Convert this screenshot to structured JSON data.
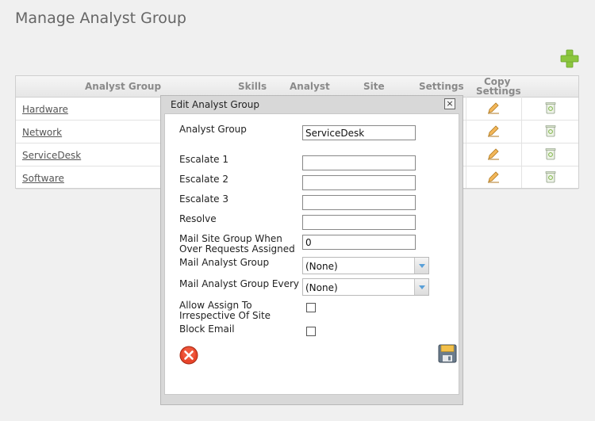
{
  "page": {
    "title": "Manage Analyst Group"
  },
  "toolbar": {
    "add_icon": "plus-icon",
    "add_color": "#8cc63f"
  },
  "grid": {
    "columns": {
      "group": "Analyst Group",
      "skills": "Skills",
      "analyst": "Analyst",
      "site": "Site",
      "settings": "Settings",
      "copy_line1": "Copy",
      "copy_line2": "Settings"
    },
    "rows": [
      {
        "name": "Hardware"
      },
      {
        "name": "Network"
      },
      {
        "name": "ServiceDesk"
      },
      {
        "name": "Software"
      }
    ],
    "row_icons": [
      "pencil-edit-icon",
      "recycle-delete-icon"
    ]
  },
  "dialog": {
    "title": "Edit Analyst Group",
    "close_label": "×",
    "fields": {
      "analyst_group": {
        "label": "Analyst Group",
        "value": "ServiceDesk"
      },
      "escalate1": {
        "label": "Escalate 1",
        "value": ""
      },
      "escalate2": {
        "label": "Escalate 2",
        "value": ""
      },
      "escalate3": {
        "label": "Escalate 3",
        "value": ""
      },
      "resolve": {
        "label": "Resolve",
        "value": ""
      },
      "mail_site": {
        "label_line1": "Mail Site Group When",
        "label_line2": "Over Requests Assigned",
        "value": "0"
      },
      "mail_group": {
        "label": "Mail Analyst Group",
        "value": "(None)"
      },
      "mail_every": {
        "label": "Mail Analyst Group Every",
        "value": "(None)"
      },
      "allow_assign": {
        "label_line1": "Allow Assign To",
        "label_line2": "Irrespective Of Site",
        "checked": false
      },
      "block_email": {
        "label": "Block Email",
        "checked": false
      }
    },
    "cancel_icon": "red-x-cancel-icon",
    "save_icon": "floppy-disk-save-icon"
  }
}
